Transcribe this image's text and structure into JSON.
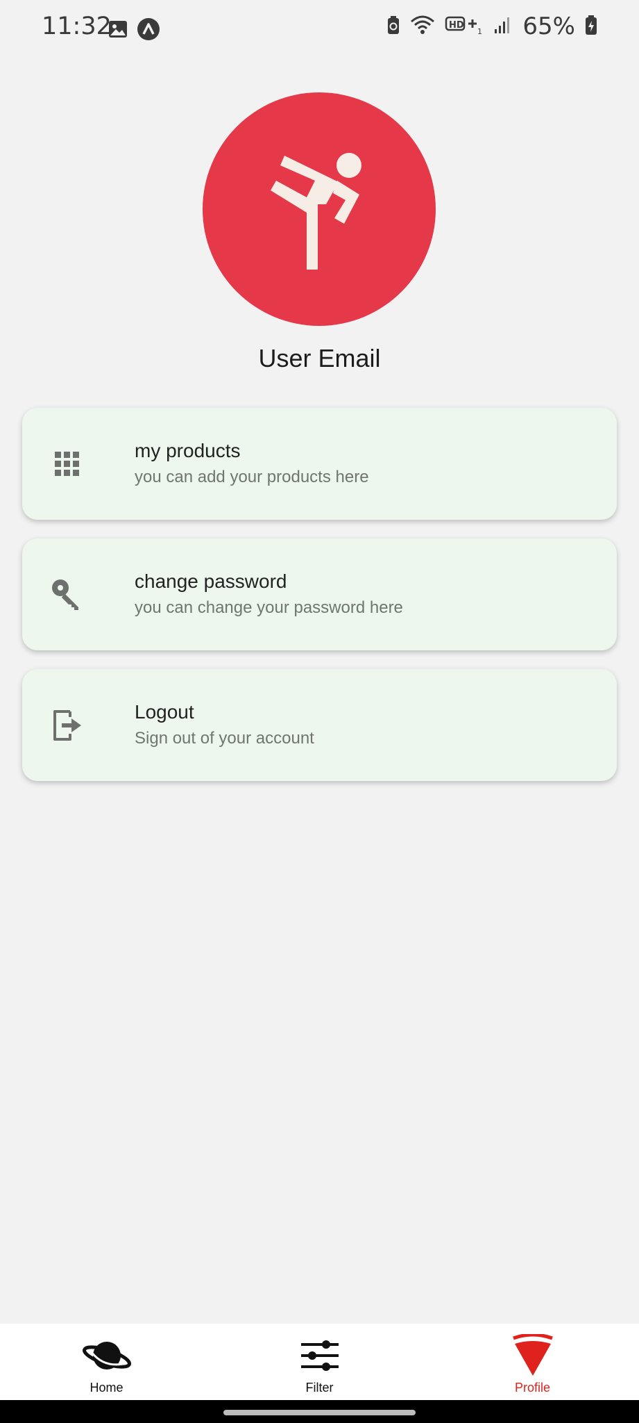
{
  "status_bar": {
    "time": "11:32",
    "left_icons": [
      "gallery-icon",
      "app-notification-icon"
    ],
    "right_icons": [
      "battery-saver-icon",
      "wifi-icon",
      "hd-plus-icon",
      "signal-icon"
    ],
    "battery_percent": "65%"
  },
  "profile": {
    "avatar_icon": "kick-figure-icon",
    "avatar_color": "#e53848",
    "email_label": "User Email"
  },
  "menu": [
    {
      "icon": "apps-grid-icon",
      "title": "my products",
      "subtitle": "you can add your products here"
    },
    {
      "icon": "key-icon",
      "title": "change password",
      "subtitle": "you can change your password here"
    },
    {
      "icon": "logout-icon",
      "title": "Logout",
      "subtitle": "Sign out of your account"
    }
  ],
  "bottom_nav": {
    "items": [
      {
        "label": "Home",
        "icon": "planet-icon",
        "active": false
      },
      {
        "label": "Filter",
        "icon": "sliders-icon",
        "active": false
      },
      {
        "label": "Profile",
        "icon": "pizza-slice-icon",
        "active": true
      }
    ],
    "active_color": "#e0221f"
  }
}
